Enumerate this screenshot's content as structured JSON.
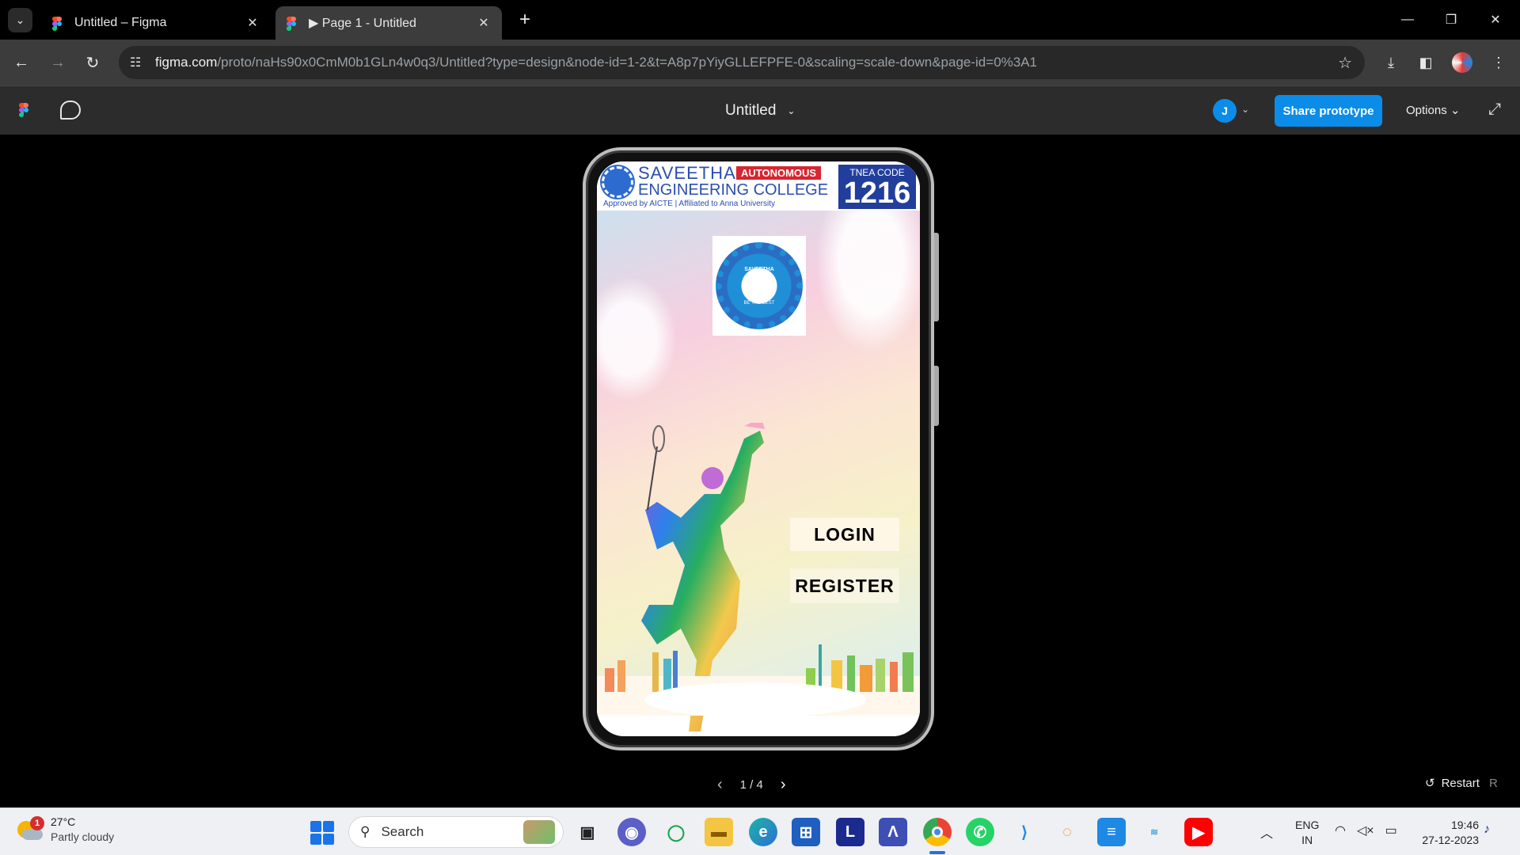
{
  "browser": {
    "tabs": [
      {
        "title": "Untitled – Figma",
        "active": false
      },
      {
        "title": "▶ Page 1 - Untitled",
        "active": true
      }
    ],
    "url_host": "figma.com",
    "url_path": "/proto/naHs90x0CmM0b1GLn4w0q3/Untitled?type=design&node-id=1-2&t=A8p7pYiyGLLEFPFE-0&scaling=scale-down&page-id=0%3A1"
  },
  "figma_bar": {
    "file_title": "Untitled",
    "avatar_initial": "J",
    "share_label": "Share prototype",
    "options_label": "Options"
  },
  "phone_screen": {
    "banner": {
      "college_name": "SAVEETHA",
      "autonomous": "AUTONOMOUS",
      "college_line2": "ENGINEERING COLLEGE",
      "subline": "Approved by AICTE | Affiliated to Anna University",
      "code_label": "TNEA CODE",
      "code_number": "1216"
    },
    "logo": {
      "name": "SAVEETHA",
      "motto": "BE THE BEST"
    },
    "login_label": "LOGIN",
    "register_label": "REGISTER"
  },
  "pager": {
    "text": "1 / 4"
  },
  "restart": {
    "label": "Restart",
    "shortcut": "R"
  },
  "taskbar": {
    "weather_badge": "1",
    "weather_temp": "27°C",
    "weather_desc": "Partly cloudy",
    "search_label": "Search",
    "lang_top": "ENG",
    "lang_bottom": "IN",
    "time": "19:46",
    "date": "27-12-2023"
  },
  "colors": {
    "accent_blue": "#0c8ce9",
    "college_blue": "#2b4fae",
    "autonomous_red": "#d7262f"
  }
}
